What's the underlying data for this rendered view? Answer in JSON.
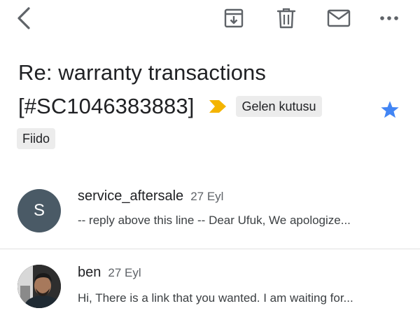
{
  "toolbar": {
    "back_icon": "back-arrow-icon",
    "archive_icon": "archive-icon",
    "delete_icon": "trash-icon",
    "mail_icon": "mark-unread-icon",
    "more_icon": "more-horizontal-icon"
  },
  "email": {
    "subject_line1": "Re: warranty transactions",
    "subject_line2": "[#SC1046383883]",
    "important_color": "#F4B400",
    "starred": true,
    "star_color": "#4285F4",
    "labels": [
      "Gelen kutusu",
      "Fiido"
    ]
  },
  "messages": [
    {
      "sender": "service_aftersale",
      "date": "27 Eyl",
      "snippet": "-- reply above this line -- Dear Ufuk, We apologize...",
      "avatar_letter": "S",
      "avatar_color": "#4A5A66"
    },
    {
      "sender": "ben",
      "date": "27 Eyl",
      "snippet": "Hi, There is a link that you wanted. I am waiting for...",
      "avatar_type": "photo"
    }
  ]
}
